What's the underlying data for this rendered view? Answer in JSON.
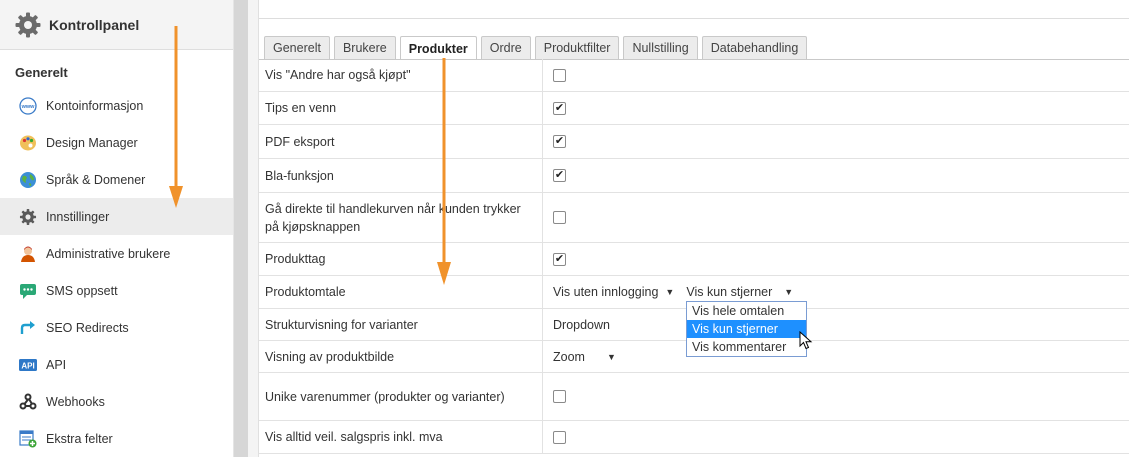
{
  "sidebar": {
    "title": "Kontrollpanel",
    "section": "Generelt",
    "items": [
      {
        "label": "Kontoinformasjon",
        "icon": "www-icon"
      },
      {
        "label": "Design Manager",
        "icon": "palette-icon"
      },
      {
        "label": "Språk & Domener",
        "icon": "globe-icon"
      },
      {
        "label": "Innstillinger",
        "icon": "gear-icon",
        "active": true
      },
      {
        "label": "Administrative brukere",
        "icon": "admin-user-icon"
      },
      {
        "label": "SMS oppsett",
        "icon": "sms-icon"
      },
      {
        "label": "SEO Redirects",
        "icon": "redirect-icon"
      },
      {
        "label": "API",
        "icon": "api-icon"
      },
      {
        "label": "Webhooks",
        "icon": "webhooks-icon"
      },
      {
        "label": "Ekstra felter",
        "icon": "extra-fields-icon"
      }
    ]
  },
  "tabs": [
    "Generelt",
    "Brukere",
    "Produkter",
    "Ordre",
    "Produktfilter",
    "Nullstilling",
    "Databehandling"
  ],
  "active_tab": "Produkter",
  "settings": {
    "rows": [
      {
        "label": "Vis \"Andre har også kjøpt\"",
        "type": "checkbox",
        "checked": false
      },
      {
        "label": "Tips en venn",
        "type": "checkbox",
        "checked": true
      },
      {
        "label": "PDF eksport",
        "type": "checkbox",
        "checked": true
      },
      {
        "label": "Bla-funksjon",
        "type": "checkbox",
        "checked": true
      },
      {
        "label": "Gå direkte til handlekurven når kunden trykker på kjøpsknappen",
        "type": "checkbox",
        "checked": false
      },
      {
        "label": "Produkttag",
        "type": "checkbox",
        "checked": true
      },
      {
        "label": "Produktomtale",
        "type": "selects",
        "select1": "Vis uten innlogging",
        "select2": "Vis kun stjerner"
      },
      {
        "label": "Strukturvisning for varianter",
        "type": "select",
        "value": "Dropdown"
      },
      {
        "label": "Visning av produktbilde",
        "type": "select",
        "value": "Zoom"
      },
      {
        "label": "Unike varenummer (produkter og varianter)",
        "type": "checkbox",
        "checked": false
      },
      {
        "label": "Vis alltid veil. salgspris inkl. mva",
        "type": "checkbox",
        "checked": false
      }
    ]
  },
  "dropdown": {
    "options": [
      "Vis hele omtalen",
      "Vis kun stjerner",
      "Vis kommentarer"
    ],
    "highlighted": "Vis kun stjerner"
  },
  "colors": {
    "arrow": "#f0922b",
    "highlight": "#1e90ff"
  }
}
